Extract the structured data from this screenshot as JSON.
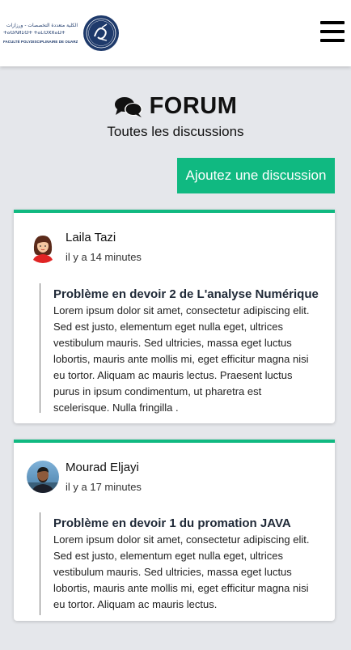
{
  "header": {
    "logo_arabic": "الكلية متعددة التخصصات - ورزازات",
    "logo_arabic_small": "ⵜⴰⵙⴷⵍⵉⵙⵜ ⵜⴰⵎⵙⴳⴳⴰⵡⵜ",
    "logo_french": "FACULTÉ POLYDISCIPLINAIRE DE OUARZAZATE"
  },
  "page": {
    "title": "FORUM",
    "subtitle": "Toutes les discussions",
    "add_button": "Ajoutez une discussion"
  },
  "discussions": [
    {
      "author": "Laila Tazi",
      "time": "il y a 14 minutes",
      "title": "Problème en devoir 2 de L'analyse Numérique",
      "body": "Lorem ipsum dolor sit amet, consectetur adipiscing elit. Sed est justo, elementum eget nulla eget, ultrices vestibulum mauris. Sed ultricies, massa eget luctus lobortis, mauris ante mollis mi, eget efficitur magna nisi eu tortor. Aliquam ac mauris lectus. Praesent luctus purus in ipsum condimentum, ut pharetra est scelerisque. Nulla fringilla ."
    },
    {
      "author": "Mourad Eljayi",
      "time": "il y a 17 minutes",
      "title": "Problème en devoir 1 du promation JAVA",
      "body": "Lorem ipsum dolor sit amet, consectetur adipiscing elit. Sed est justo, elementum eget nulla eget, ultrices vestibulum mauris. Sed ultricies, massa eget luctus lobortis, mauris ante mollis mi, eget efficitur magna nisi eu tortor. Aliquam ac mauris lectus."
    }
  ],
  "colors": {
    "accent": "#10b981",
    "background": "#e5e7eb",
    "logo_blue": "#1e3a6b"
  },
  "icons": {
    "title": "comments-icon",
    "menu": "hamburger-menu-icon"
  }
}
